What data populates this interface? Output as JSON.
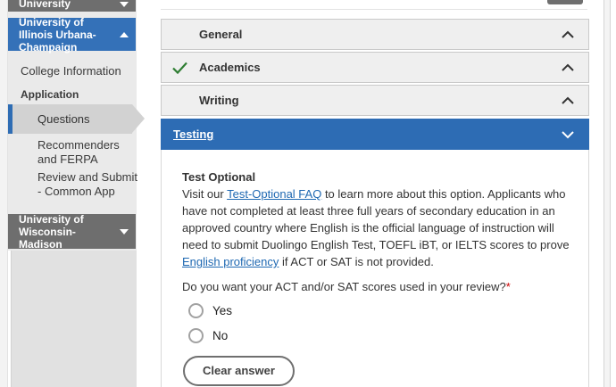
{
  "sidebar": {
    "colleges": [
      {
        "name": "New York University",
        "state": "collapsed"
      },
      {
        "name": "University of Illinois Urbana-Champaign",
        "state": "expanded"
      },
      {
        "name": "University of Wisconsin-Madison",
        "state": "collapsed"
      }
    ],
    "nav": {
      "college_information": "College Information",
      "application_group": "Application",
      "items": [
        {
          "label": "Questions",
          "selected": true
        },
        {
          "label": "Recommenders and FERPA",
          "selected": false
        },
        {
          "label": "Review and Submit - Common App",
          "selected": false
        }
      ]
    }
  },
  "main": {
    "sections": [
      {
        "label": "General",
        "status": "collapsed",
        "chevron": "up"
      },
      {
        "label": "Academics",
        "status": "complete",
        "chevron": "up"
      },
      {
        "label": "Writing",
        "status": "collapsed",
        "chevron": "up"
      },
      {
        "label": "Testing",
        "status": "active",
        "chevron": "down"
      }
    ],
    "testing": {
      "heading": "Test Optional",
      "intro": {
        "before_link1": "Visit our ",
        "link1": "Test-Optional FAQ",
        "between_links": " to learn more about this option. Applicants who have not completed at least three full years of secondary education in an approved country where English is the official language of instruction will need to submit Duolingo English Test, TOEFL iBT, or IELTS scores to prove ",
        "link2": "English proficiency",
        "after_link2": " if ACT or SAT is not provided."
      },
      "question": {
        "text": "Do you want your ACT and/or SAT scores used in your review?",
        "required_marker": "*"
      },
      "options": [
        {
          "label": "Yes",
          "checked": false
        },
        {
          "label": "No",
          "checked": false
        }
      ],
      "clear_button": "Clear answer"
    }
  },
  "colors": {
    "accent_blue": "#2d6cb4",
    "header_gray": "#6e6e6e",
    "check_green": "#2e7d32",
    "link_blue": "#1e68b2",
    "required_red": "#cc0000",
    "selected_item_gray": "#d2d2d2"
  }
}
